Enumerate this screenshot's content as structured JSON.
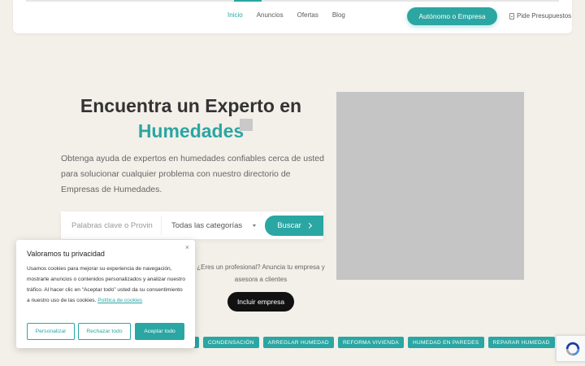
{
  "nav": {
    "items": [
      {
        "label": "Inicio",
        "active": true
      },
      {
        "label": "Anuncios",
        "active": false
      },
      {
        "label": "Ofertas",
        "active": false
      },
      {
        "label": "Blog",
        "active": false
      }
    ],
    "cta_label": "Autónomo o Empresa",
    "quote_label": "Pide Presupuestos"
  },
  "hero": {
    "title_line1": "Encuentra un Experto en",
    "title_accent": "Humedades",
    "description": "Obtenga ayuda de expertos en humedades confiables cerca de usted para solucionar cualquier problema con nuestro directorio de Empresas de Humedades."
  },
  "search": {
    "keyword_placeholder": "Palabras clave o Provin",
    "category_value": "Todas las categorías",
    "button_label": "Buscar"
  },
  "pro": {
    "text": "¿Eres un profesional? Anuncia tu empresa y asesora a clientes",
    "button_label": "Incluir empresa"
  },
  "tags": [
    "CONDENSACIÓN",
    "ARREGLAR HUMEDAD",
    "REFORMA VIVIENDA",
    "HUMEDAD EN PAREDES",
    "REPARAR HUMEDAD"
  ],
  "cookie": {
    "title": "Valoramos tu privacidad",
    "close": "×",
    "text": "Usamos cookies para mejorar su experiencia de navegación, mostrarle anuncios o contenidos personalizados y analizar nuestro tráfico. Al hacer clic en “Aceptar todo” usted da su consentimiento a nuestro uso de las cookies.",
    "policy_link": "Política de cookies",
    "customize_label": "Personalizar",
    "reject_label": "Rechazar todo",
    "accept_label": "Aceptar todo"
  },
  "colors": {
    "accent": "#2aa6a3",
    "background": "#f3efe9",
    "dark": "#111111"
  }
}
